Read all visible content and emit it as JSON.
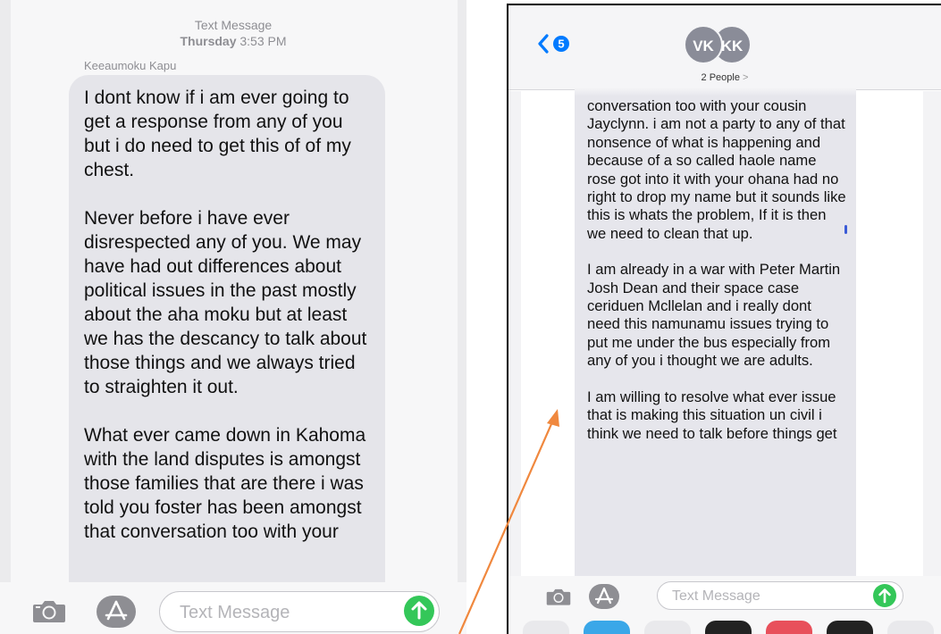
{
  "left_screen": {
    "header_title": "Text Message",
    "header_day": "Thursday",
    "header_time": "3:53 PM",
    "sender_name": "Keeaumoku Kapu",
    "message_paragraphs": [
      "I dont know if i am ever going to get a response from any of you but i do need to get this of of my chest.",
      "Never before i have ever disrespected any of you. We may have had out differences about political issues in the past mostly about the aha moku but at least we has the descancy to talk about those things and we  always tried to straighten it out.",
      "What ever came down in Kahoma with the land disputes is amongst those families that are there i was told you foster has been amongst that conversation too with your"
    ],
    "input_placeholder": "Text Message",
    "icons": [
      "camera-icon",
      "app-store-icon",
      "send-arrow-icon"
    ]
  },
  "right_screen": {
    "back_badge_count": "5",
    "avatars": [
      "VK",
      "KK"
    ],
    "people_label": "2 People",
    "people_chevron": ">",
    "message_paragraphs": [
      "conversation too with your cousin Jayclynn. i am not a party to any of that nonsence of what is happening and because of a so called haole name rose got into it with your ohana  had no right to drop my name but it sounds like this is whats the problem, If it is then we need to clean that up.",
      "I am already in a war with Peter Martin Josh Dean and their space case ceriduen Mcllelan and i really dont need this namunamu issues trying to put me under the bus especially from any of you i thought we are adults.",
      "I am willing to resolve what ever issue that is making this situation un civil i think we need to talk before things get"
    ],
    "input_placeholder": "Text Message",
    "icons": [
      "back-chevron-icon",
      "camera-icon",
      "app-store-icon",
      "send-arrow-icon"
    ],
    "dock_colors": [
      "#e9e9ec",
      "#3aa7e8",
      "#e9e9ec",
      "#222222",
      "#e8505b",
      "#222222",
      "#e9e9ec"
    ]
  },
  "colors": {
    "bubble_gray": "#e5e5ea",
    "send_green": "#34c759",
    "ios_blue": "#007aff",
    "annotation_arrow": "#f0883e"
  }
}
